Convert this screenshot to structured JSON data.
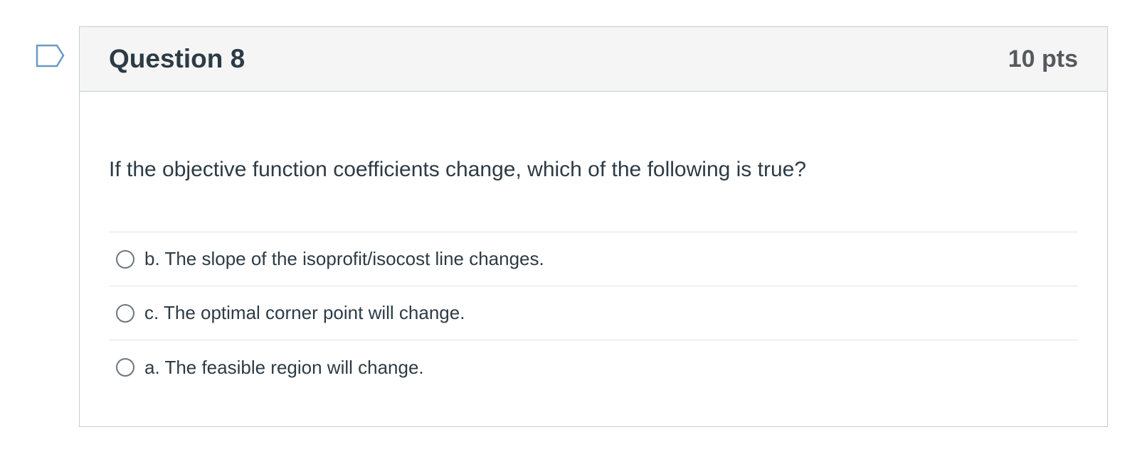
{
  "question": {
    "title": "Question 8",
    "points": "10 pts",
    "text": "If the objective function coefficients change, which of the following is true?",
    "flag_icon": "bookmark-flag-icon",
    "flag_color": "#5b8fb9"
  },
  "answers": [
    {
      "label": "b. The slope of the isoprofit/isocost line changes.",
      "selected": false
    },
    {
      "label": "c. The optimal corner point will change.",
      "selected": false
    },
    {
      "label": "a. The feasible region will change.",
      "selected": false
    }
  ]
}
